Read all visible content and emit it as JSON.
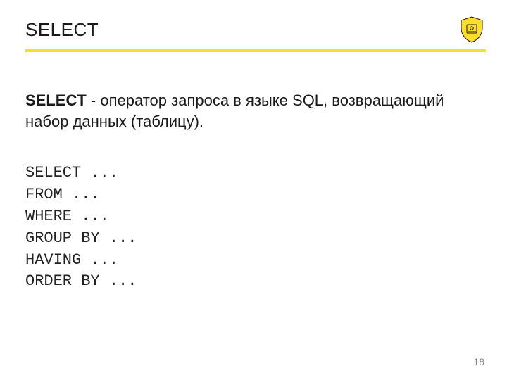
{
  "header": {
    "title": "SELECT"
  },
  "definition": {
    "term": "SELECT",
    "rest": " - оператор запроса в языке SQL, возвращающий набор данных (таблицу)."
  },
  "code_lines": [
    "SELECT ...",
    "FROM ...",
    "WHERE ...",
    "GROUP BY ...",
    "HAVING ...",
    "ORDER BY ..."
  ],
  "page_number": "18",
  "colors": {
    "accent": "#ffdd2d"
  }
}
